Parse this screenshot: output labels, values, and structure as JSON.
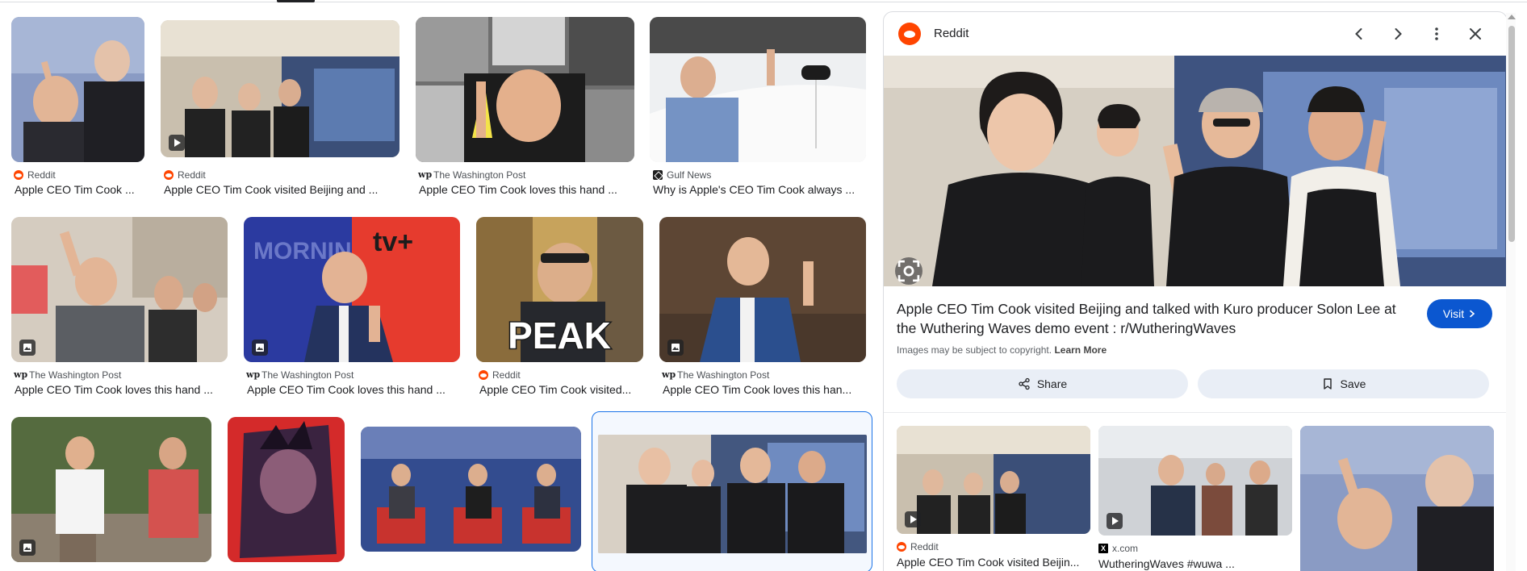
{
  "colors": {
    "accent": "#1a73e8",
    "visit_button": "#0b57d0",
    "reddit_orange": "#ff4500",
    "action_button": "#e9eef6"
  },
  "results": [
    {
      "source": "Reddit",
      "favicon": "reddit-icon",
      "title": "Apple CEO Tim Cook ...",
      "badge": "none"
    },
    {
      "source": "Reddit",
      "favicon": "reddit-icon",
      "title": "Apple CEO Tim Cook visited Beijing and ...",
      "badge": "video"
    },
    {
      "source": "The Washington Post",
      "favicon": "washington-post-icon",
      "title": "Apple CEO Tim Cook loves this hand ...",
      "badge": "none"
    },
    {
      "source": "Gulf News",
      "favicon": "gulf-news-icon",
      "title": "Why is Apple's CEO Tim Cook always ...",
      "badge": "none"
    },
    {
      "source": "The Washington Post",
      "favicon": "washington-post-icon",
      "title": "Apple CEO Tim Cook loves this hand ...",
      "badge": "image"
    },
    {
      "source": "The Washington Post",
      "favicon": "washington-post-icon",
      "title": "Apple CEO Tim Cook loves this hand ...",
      "badge": "image"
    },
    {
      "source": "Reddit",
      "favicon": "reddit-icon",
      "title": "Apple CEO Tim Cook visited...",
      "badge": "none",
      "overlay_text": "PEAK"
    },
    {
      "source": "The Washington Post",
      "favicon": "washington-post-icon",
      "title": "Apple CEO Tim Cook loves this han...",
      "badge": "image"
    },
    {
      "source": "",
      "title": "",
      "badge": "image"
    },
    {
      "source": "",
      "title": "",
      "badge": "none"
    },
    {
      "source": "",
      "title": "",
      "badge": "none"
    },
    {
      "source": "",
      "title": "",
      "badge": "none",
      "selected": true
    }
  ],
  "panel": {
    "source": "Reddit",
    "source_icon": "reddit-icon",
    "title": "Apple CEO Tim Cook visited Beijing and talked with Kuro producer Solon Lee at the Wuthering Waves demo event : r/WutheringWaves",
    "visit_label": "Visit",
    "copyright_text": "Images may be subject to copyright.",
    "learn_more": "Learn More",
    "share_label": "Share",
    "save_label": "Save",
    "icons": [
      "chevron-left-icon",
      "chevron-right-icon",
      "more-vert-icon",
      "close-icon",
      "google-lens-icon",
      "share-icon",
      "bookmark-icon"
    ],
    "related": [
      {
        "source": "Reddit",
        "favicon": "reddit-icon",
        "title": "Apple CEO Tim Cook visited Beijin...",
        "badge": "video"
      },
      {
        "source": "x.com",
        "favicon": "x-icon",
        "title": "WutheringWaves #wuwa ...",
        "badge": "video"
      },
      {
        "source": "",
        "title": "",
        "badge": "none"
      }
    ]
  }
}
